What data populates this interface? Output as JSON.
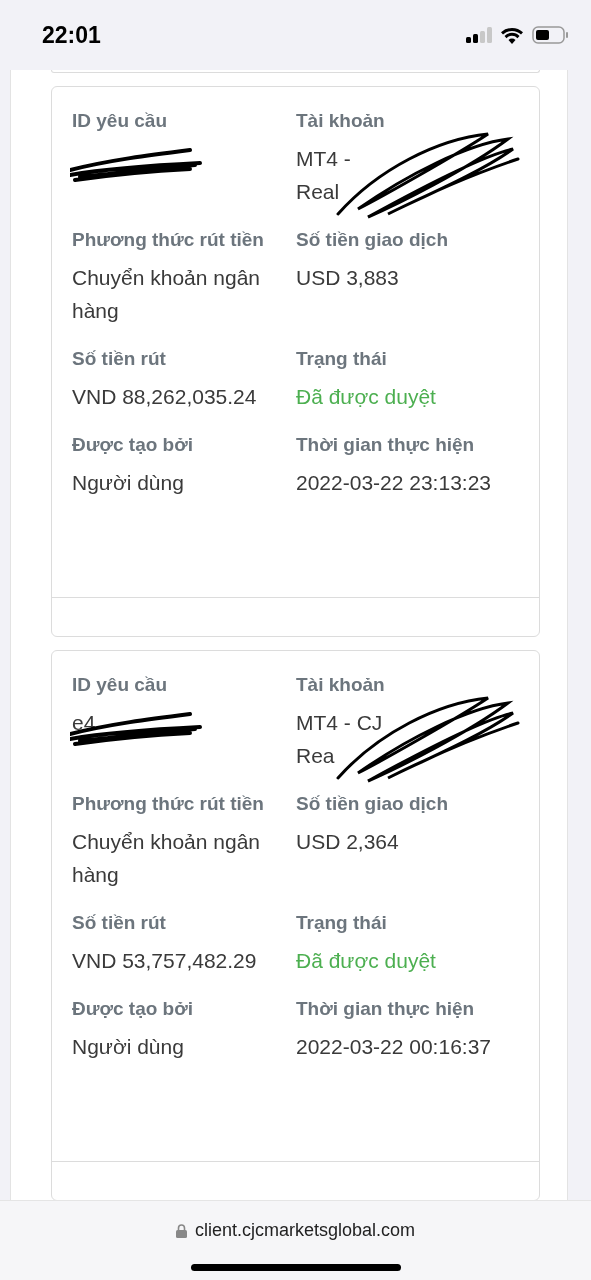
{
  "status_bar": {
    "time": "22:01"
  },
  "requests": [
    {
      "fields": [
        {
          "kind": "redacted",
          "label": "ID yêu cầu"
        },
        {
          "kind": "redacted",
          "label": "Tài khoản",
          "lines": [
            [
              "MT4 -"
            ],
            [
              "Real"
            ]
          ]
        },
        {
          "kind": "text",
          "label": "Phương thức rút tiền",
          "value": "Chuyển khoản ngân hàng"
        },
        {
          "kind": "text",
          "label": "Số tiền giao dịch",
          "value": "USD 3,883"
        },
        {
          "kind": "text",
          "label": "Số tiền rút",
          "value": "VND 88,262,035.24"
        },
        {
          "kind": "status",
          "label": "Trạng thái",
          "value": "Đã được duyệt",
          "color": "#4caf50"
        },
        {
          "kind": "text",
          "label": "Được tạo bởi",
          "value": "Người dùng"
        },
        {
          "kind": "text",
          "label": "Thời gian thực hiện",
          "value": "2022-03-22 23:13:23"
        }
      ]
    },
    {
      "fields": [
        {
          "kind": "redacted",
          "label": "ID yêu cầu",
          "lines": [
            [
              "e4"
            ]
          ]
        },
        {
          "kind": "redacted",
          "label": "Tài khoản",
          "lines": [
            [
              "MT4 - CJ"
            ],
            [
              "Rea"
            ]
          ]
        },
        {
          "kind": "text",
          "label": "Phương thức rút tiền",
          "value": "Chuyển khoản ngân hàng"
        },
        {
          "kind": "text",
          "label": "Số tiền giao dịch",
          "value": "USD 2,364"
        },
        {
          "kind": "text",
          "label": "Số tiền rút",
          "value": "VND 53,757,482.29"
        },
        {
          "kind": "status",
          "label": "Trạng thái",
          "value": "Đã được duyệt",
          "color": "#4caf50"
        },
        {
          "kind": "text",
          "label": "Được tạo bởi",
          "value": "Người dùng"
        },
        {
          "kind": "text",
          "label": "Thời gian thực hiện",
          "value": "2022-03-22 00:16:37"
        }
      ]
    }
  ],
  "browser_bar": {
    "url": "client.cjcmarketsglobal.com"
  }
}
